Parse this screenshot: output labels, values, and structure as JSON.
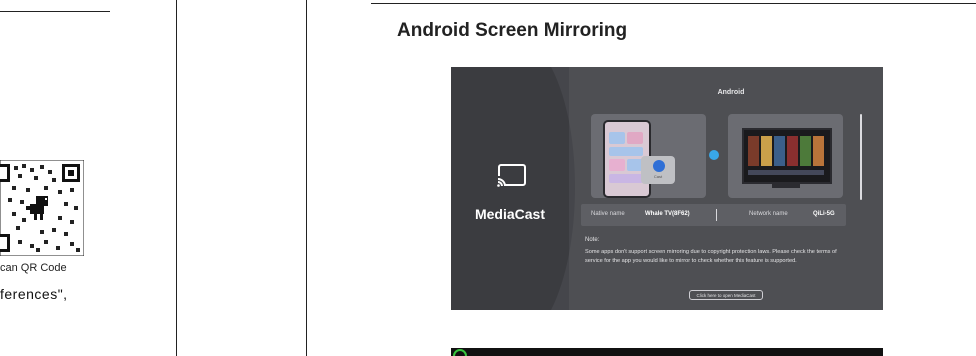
{
  "left_column": {
    "qr_caption": "can QR Code",
    "text_fragment": "ferences\","
  },
  "section": {
    "title": "Android Screen Mirroring"
  },
  "mirroring_screen": {
    "icon": "cast-icon",
    "app_name": "MediaCast",
    "screen_title": "Android",
    "phone_popup_label": "Cast",
    "info": {
      "native_name_label": "Native name",
      "native_name_value": "Whale TV(8F62)",
      "network_name_label": "Network name",
      "network_name_value": "QiLi-5G"
    },
    "note_heading": "Note:",
    "note_body": "Some apps don't support screen mirroring due to copyright protection laws. Please check the terms of service for the app you would like to mirror to check whether this feature is supported.",
    "open_button": "Click here to open MediaCast",
    "colors": {
      "background": "#4e4f53",
      "side_panel": "#3b3c40",
      "link_indicator": "#39a7e8",
      "cast_accent": "#2f6fd6"
    }
  },
  "next_screen": {
    "icon": "green-ring-logo"
  }
}
